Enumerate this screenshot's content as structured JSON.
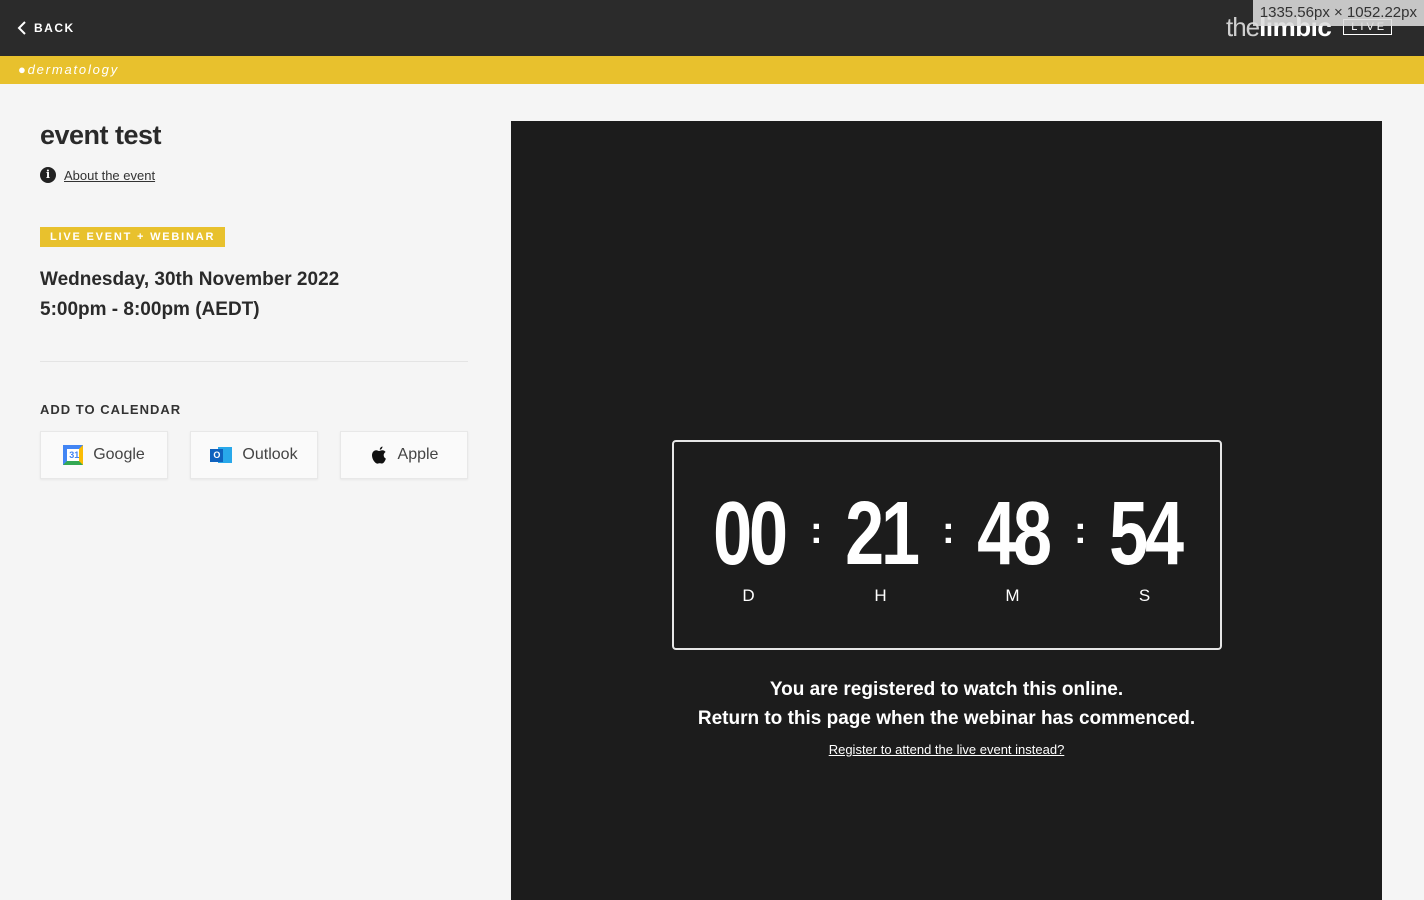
{
  "topbar": {
    "back_label": "BACK",
    "brand_the": "the",
    "brand_limbic": "limbic",
    "brand_live": "LIVE",
    "dimension_overlay": "1335.56px × 1052.22px"
  },
  "strip": {
    "label": "●dermatology",
    "color": "#e8c12d"
  },
  "event": {
    "title": "event test",
    "about_link": "About the event",
    "badge": "LIVE EVENT + WEBINAR",
    "date": "Wednesday, 30th November 2022",
    "time": "5:00pm - 8:00pm (AEDT)"
  },
  "calendar": {
    "heading": "ADD TO CALENDAR",
    "buttons": [
      {
        "label": "Google",
        "icon": "google-calendar-icon"
      },
      {
        "label": "Outlook",
        "icon": "outlook-icon"
      },
      {
        "label": "Apple",
        "icon": "apple-icon"
      }
    ]
  },
  "countdown": {
    "units": [
      {
        "value": "00",
        "label": "D"
      },
      {
        "value": "21",
        "label": "H"
      },
      {
        "value": "48",
        "label": "M"
      },
      {
        "value": "54",
        "label": "S"
      }
    ],
    "separator": ":"
  },
  "message": {
    "line1": "You are registered to watch this online.",
    "line2": "Return to this page when the webinar has commenced.",
    "register_link": "Register to attend the live event instead?"
  }
}
